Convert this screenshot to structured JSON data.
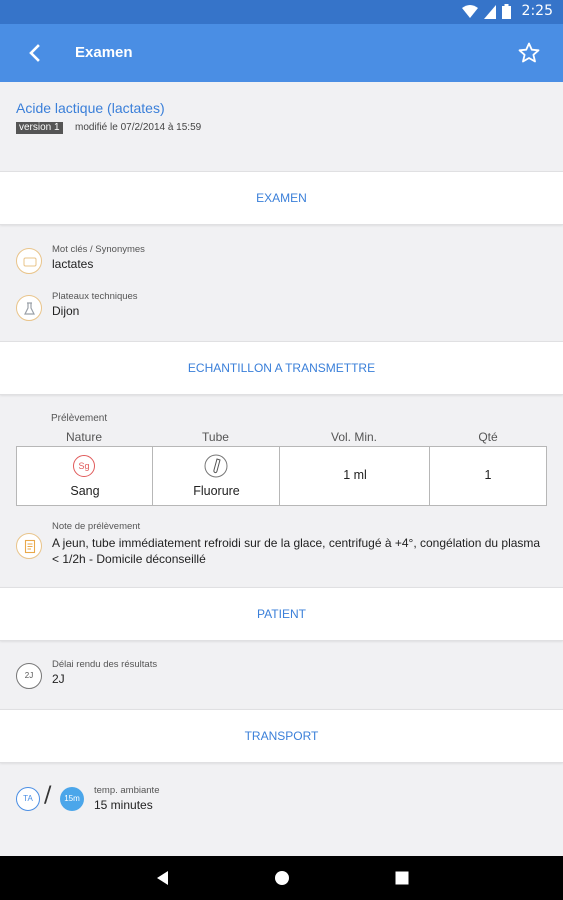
{
  "status_bar": {
    "time": "2:25",
    "icons": [
      "wifi-icon",
      "signal-icon",
      "battery-icon"
    ]
  },
  "app_bar": {
    "title": "Examen",
    "back_icon": "chevron-left-icon",
    "favorite_icon": "star-outline-icon"
  },
  "exam": {
    "name": "Acide lactique (lactates)",
    "version": "version 1",
    "modified": "modifié le  07/2/2014 à 15:59"
  },
  "sections": {
    "examen": "EXAMEN",
    "echantillon": "ECHANTILLON A TRANSMETTRE",
    "patient": "PATIENT",
    "transport": "TRANSPORT"
  },
  "examen_info": [
    {
      "icon": "tag-icon",
      "label": "Mot clés / Synonymes",
      "value": "lactates"
    },
    {
      "icon": "flask-icon",
      "label": "Plateaux techniques",
      "value": "Dijon"
    }
  ],
  "sample": {
    "prelevement_label": "Prélèvement",
    "headers": [
      "Nature",
      "Tube",
      "Vol. Min.",
      "Qté"
    ],
    "row": {
      "nature_icon_text": "Sg",
      "nature": "Sang",
      "tube": "Fluorure",
      "vol_min": "1 ml",
      "qty": "1"
    },
    "note_label": "Note de prélèvement",
    "note": "A jeun, tube immédiatement refroidi sur de la glace, centrifugé à +4°, congélation du plasma < 1/2h - Domicile déconseillé"
  },
  "patient": {
    "icon_text": "2J",
    "label": "Délai rendu des résultats",
    "value": "2J"
  },
  "transport": {
    "temp_icon_text": "TA",
    "duration_icon_text": "15m",
    "label": "temp. ambiante",
    "value": "15 minutes"
  },
  "colors": {
    "primary": "#4a8ee4",
    "status_bar": "#3674c9",
    "accent_text": "#3a7fd9",
    "orange_icon": "#e9a84a"
  }
}
